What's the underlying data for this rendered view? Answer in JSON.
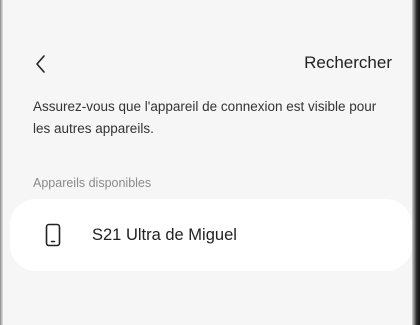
{
  "header": {
    "back_icon": "chevron-left-icon",
    "action_label": "Rechercher"
  },
  "info_text": "Assurez-vous que l'appareil de connexion est visible pour les autres appareils.",
  "section_label": "Appareils disponibles",
  "devices": [
    {
      "icon": "smartphone-icon",
      "name": "S21 Ultra de Miguel"
    }
  ],
  "colors": {
    "background": "#f6f6f6",
    "card": "#ffffff",
    "text_primary": "#222222",
    "text_secondary": "#8a8a8a"
  }
}
